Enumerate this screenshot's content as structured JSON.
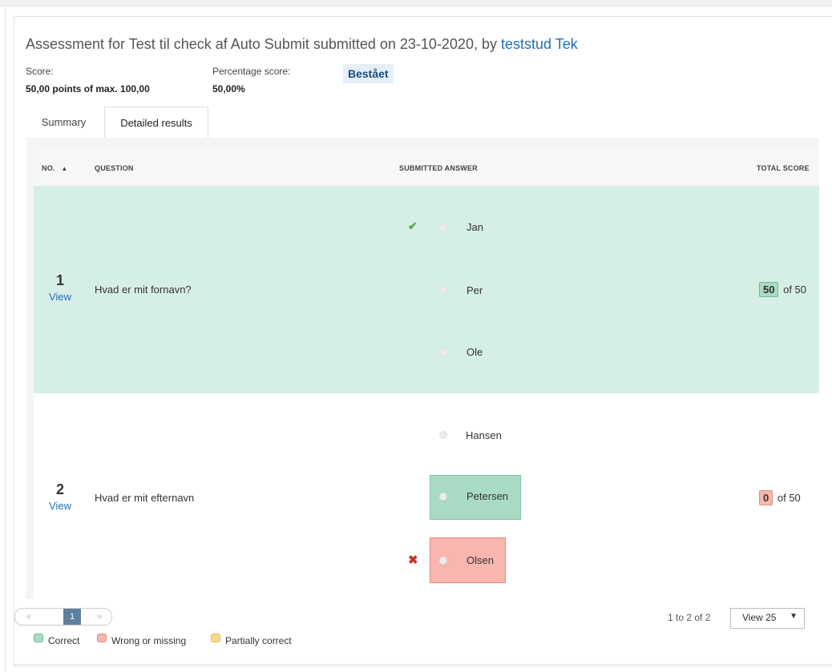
{
  "header": {
    "title_prefix": "Assessment for Test til check af Auto Submit submitted on 23-10-2020, by",
    "student": "teststud Tek",
    "score_label": "Score:",
    "score_value": "50,00 points of max. 100,00",
    "percentage_label": "Percentage score:",
    "percentage_value": "50,00%",
    "status_badge": "Bestået"
  },
  "tabs": [
    {
      "label": "Summary"
    },
    {
      "label": "Detailed results"
    }
  ],
  "table": {
    "columns": {
      "no": "NO.",
      "question": "QUESTION",
      "answer": "SUBMITTED ANSWER",
      "score": "TOTAL SCORE"
    },
    "rows": [
      {
        "number": "1",
        "view": "View",
        "question": "Hvad er mit fornavn?",
        "answers": [
          "Jan",
          "Per",
          "Ole"
        ],
        "score": "50",
        "of": "of 50"
      },
      {
        "number": "2",
        "view": "View",
        "question": "Hvad er mit efternavn",
        "answers": [
          "Hansen",
          "Petersen",
          "Olsen"
        ],
        "score": "0",
        "of": "of 50"
      }
    ]
  },
  "pagination": {
    "prev": "«",
    "current": "1",
    "next": "»",
    "count": "1 to 2 of 2",
    "view_select": "View 25"
  },
  "legend": {
    "correct": "Correct",
    "wrong": "Wrong or missing",
    "partial": "Partially correct"
  },
  "colors": {
    "correct_row": "#d6efe6",
    "correct": "#a9dbc4",
    "wrong": "#f8b6ae",
    "partial": "#f8d98c",
    "link": "#1f6fb5"
  }
}
